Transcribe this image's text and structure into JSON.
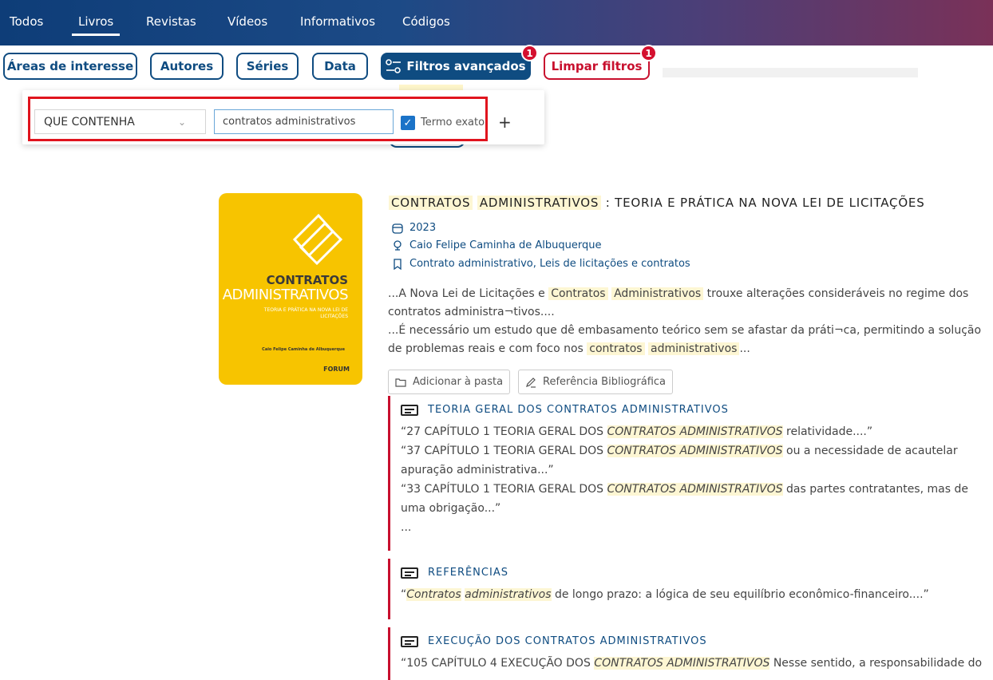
{
  "nav": {
    "tabs": [
      {
        "label": "Todos"
      },
      {
        "label": "Livros"
      },
      {
        "label": "Revistas"
      },
      {
        "label": "Vídeos"
      },
      {
        "label": "Informativos"
      },
      {
        "label": "Códigos"
      }
    ],
    "active": "Livros"
  },
  "filters": {
    "areas": "Áreas de interesse",
    "autores": "Autores",
    "series": "Séries",
    "data": "Data",
    "advanced": "Filtros avançados",
    "advanced_badge": "1",
    "clear": "Limpar filtros",
    "clear_badge": "1"
  },
  "advanced_panel": {
    "condition": "QUE CONTENHA",
    "term": "contratos administrativos",
    "exact_label": "Termo exato",
    "exact_checked": true,
    "add": "+"
  },
  "book": {
    "cover": {
      "title": "CONTRATOS",
      "subtitle": "ADMINISTRATIVOS",
      "tagline": "TEORIA E PRÁTICA NA NOVA LEI DE LICITAÇÕES",
      "author": "Caio Felipe Caminha de Albuquerque",
      "publisher": "FORUM"
    },
    "title_hl1": "CONTRATOS",
    "title_hl2": "ADMINISTRATIVOS",
    "title_rest": ": TEORIA E PRÁTICA NA NOVA LEI DE LICITAÇÕES",
    "year": "2023",
    "author": "Caio Felipe Caminha de Albuquerque",
    "subjects": "Contrato administrativo, Leis de licitações e contratos",
    "excerpt1_a": "...A Nova Lei de Licitações e ",
    "excerpt1_hl1": "Contratos",
    "excerpt1_hl2": "Administrativos",
    "excerpt1_b": " trouxe alterações consideráveis no regime dos contratos administra¬tivos....",
    "excerpt2_a": "...É necessário um estudo que dê embasamento teórico sem se afastar da práti¬ca, permitindo a solução de problemas reais e com foco nos ",
    "excerpt2_hl1": "contratos",
    "excerpt2_hl2": "administrativos",
    "excerpt2_b": "...",
    "add_folder": "Adicionar à pasta",
    "reference": "Referência Bibliográfica"
  },
  "chapters": [
    {
      "title": "TEORIA GERAL DOS CONTRATOS ADMINISTRATIVOS",
      "q1_a": "“27 CAPÍTULO 1 TEORIA GERAL DOS ",
      "q1_hl": "CONTRATOS ADMINISTRATIVOS",
      "q1_b": " relatividade....”",
      "q2_a": "“37 CAPÍTULO 1 TEORIA GERAL DOS ",
      "q2_hl": "CONTRATOS ADMINISTRATIVOS",
      "q2_b": " ou a necessidade de acautelar apuração administrativa...”",
      "q3_a": "“33 CAPÍTULO 1 TEORIA GERAL DOS ",
      "q3_hl": "CONTRATOS ADMINISTRATIVOS",
      "q3_b": " das partes contratantes, mas de uma obrigação...”",
      "more": "..."
    },
    {
      "title": "REFERÊNCIAS",
      "q1_a": "“",
      "q1_hl1": "Contratos",
      "q1_hl2": "administrativos",
      "q1_b": " de longo prazo: a lógica de seu equilíbrio econômico-financeiro....”"
    },
    {
      "title": "EXECUÇÃO DOS CONTRATOS ADMINISTRATIVOS",
      "q1_a": "“105 CAPÍTULO 4 EXECUÇÃO DOS ",
      "q1_hl": "CONTRATOS ADMINISTRATIVOS",
      "q1_b": " Nesse sentido, a responsabilidade do"
    }
  ],
  "colors": {
    "brand": "#0f4c81",
    "danger": "#c8102e",
    "highlight": "#fdf6d3"
  }
}
